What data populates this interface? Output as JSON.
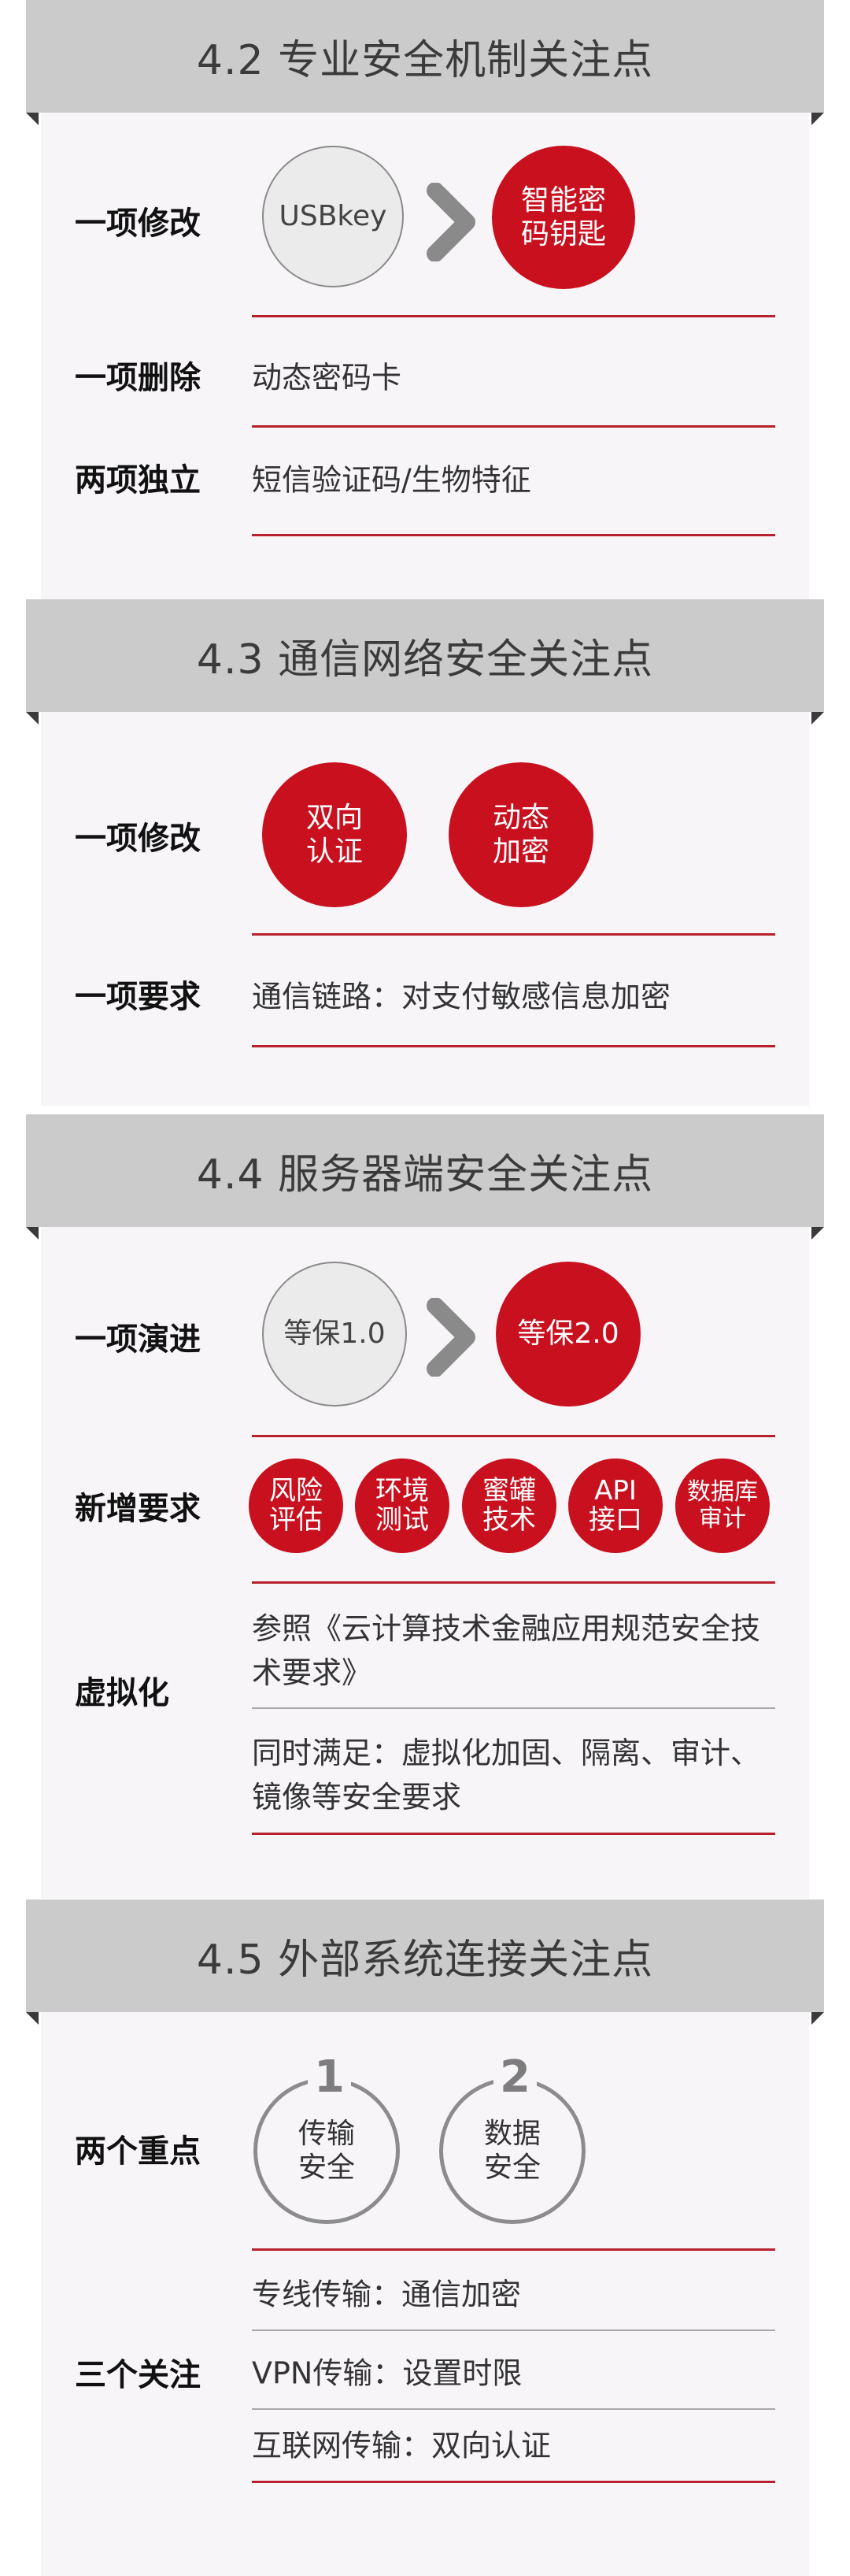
{
  "sections": [
    {
      "title": "4.2 专业安全机制关注点",
      "modify_label": "一项修改",
      "from": "USBkey",
      "to": [
        "智能密",
        "码钥匙"
      ],
      "delete_label": "一项删除",
      "delete_text": "动态密码卡",
      "independent_label": "两项独立",
      "independent_text": "短信验证码/生物特征"
    },
    {
      "title": "4.3 通信网络安全关注点",
      "modify_label": "一项修改",
      "circles": [
        [
          "双向",
          "认证"
        ],
        [
          "动态",
          "加密"
        ]
      ],
      "require_label": "一项要求",
      "require_text": "通信链路：对支付敏感信息加密"
    },
    {
      "title": "4.4 服务器端安全关注点",
      "evolve_label": "一项演进",
      "from": "等保1.0",
      "to": "等保2.0",
      "new_label": "新增要求",
      "new_items": [
        [
          "风险",
          "评估"
        ],
        [
          "环境",
          "测试"
        ],
        [
          "蜜罐",
          "技术"
        ],
        [
          "API",
          "接口"
        ],
        [
          "数据库",
          "审计"
        ]
      ],
      "virt_label": "虚拟化",
      "virt_text_1": "参照《云计算技术金融应用规范安全技术要求》",
      "virt_text_2": "同时满足：虚拟化加固、隔离、审计、镜像等安全要求"
    },
    {
      "title": "4.5 外部系统连接关注点",
      "focus_label": "两个重点",
      "focus": [
        {
          "num": "1",
          "lines": [
            "传输",
            "安全"
          ]
        },
        {
          "num": "2",
          "lines": [
            "数据",
            "安全"
          ]
        }
      ],
      "attention_label": "三个关注",
      "attention": [
        "专线传输：通信加密",
        "VPN传输：设置时限",
        "互联网传输：双向认证"
      ]
    }
  ],
  "colors": {
    "accent_red": "#c8101f",
    "rule_red": "#b8202e",
    "banner_grey": "#cbcbcb",
    "panel_bg": "#f7f5f8"
  },
  "icons": {
    "arrow": "chevron-right-icon"
  }
}
